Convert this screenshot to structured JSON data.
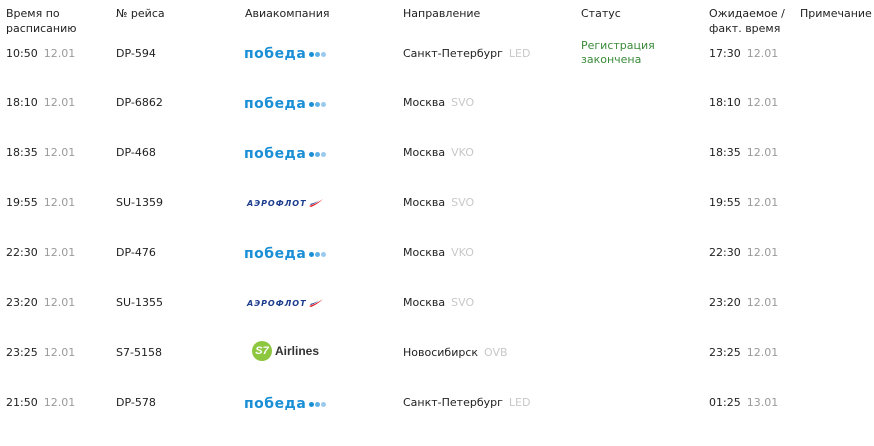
{
  "headers": {
    "sched_line1": "Время по",
    "sched_line2": "расписанию",
    "flight": "№ рейса",
    "airline": "Авиакомпания",
    "direction": "Направление",
    "status": "Статус",
    "expected_line1": "Ожидаемое /",
    "expected_line2": "факт. время",
    "note": "Примечание"
  },
  "logos": {
    "pobeda_text": "победа",
    "aeroflot_text": "АЭРОФЛОТ",
    "s7_circle": "S7",
    "s7_text": "Airlines"
  },
  "colors": {
    "pobeda_blue": "#1a8fd6",
    "aeroflot_blue": "#1b3b8c",
    "aeroflot_red": "#e31e24",
    "s7_green": "#8dc63f",
    "status_green": "#3a8a3a"
  },
  "flights": [
    {
      "time": "10:50",
      "date": "12.01",
      "flight": "DP-594",
      "airline": "pobeda",
      "city": "Санкт-Петербург",
      "iata": "LED",
      "status": "Регистрация закончена",
      "exp_time": "17:30",
      "exp_date": "12.01",
      "note": ""
    },
    {
      "time": "18:10",
      "date": "12.01",
      "flight": "DP-6862",
      "airline": "pobeda",
      "city": "Москва",
      "iata": "SVO",
      "status": "",
      "exp_time": "18:10",
      "exp_date": "12.01",
      "note": ""
    },
    {
      "time": "18:35",
      "date": "12.01",
      "flight": "DP-468",
      "airline": "pobeda",
      "city": "Москва",
      "iata": "VKO",
      "status": "",
      "exp_time": "18:35",
      "exp_date": "12.01",
      "note": ""
    },
    {
      "time": "19:55",
      "date": "12.01",
      "flight": "SU-1359",
      "airline": "aeroflot",
      "city": "Москва",
      "iata": "SVO",
      "status": "",
      "exp_time": "19:55",
      "exp_date": "12.01",
      "note": ""
    },
    {
      "time": "22:30",
      "date": "12.01",
      "flight": "DP-476",
      "airline": "pobeda",
      "city": "Москва",
      "iata": "VKO",
      "status": "",
      "exp_time": "22:30",
      "exp_date": "12.01",
      "note": ""
    },
    {
      "time": "23:20",
      "date": "12.01",
      "flight": "SU-1355",
      "airline": "aeroflot",
      "city": "Москва",
      "iata": "SVO",
      "status": "",
      "exp_time": "23:20",
      "exp_date": "12.01",
      "note": ""
    },
    {
      "time": "23:25",
      "date": "12.01",
      "flight": "S7-5158",
      "airline": "s7",
      "city": "Новосибирск",
      "iata": "OVB",
      "status": "",
      "exp_time": "23:25",
      "exp_date": "12.01",
      "note": ""
    },
    {
      "time": "21:50",
      "date": "12.01",
      "flight": "DP-578",
      "airline": "pobeda",
      "city": "Санкт-Петербург",
      "iata": "LED",
      "status": "",
      "exp_time": "01:25",
      "exp_date": "13.01",
      "note": ""
    }
  ]
}
